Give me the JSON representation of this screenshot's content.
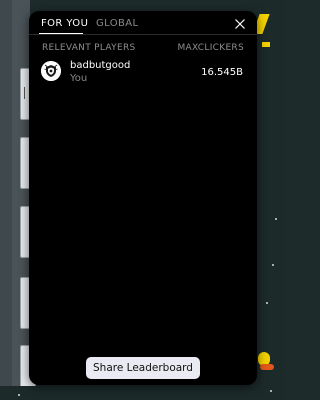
{
  "tabs": [
    {
      "label": "FOR YOU",
      "active": true
    },
    {
      "label": "GLOBAL",
      "active": false
    }
  ],
  "close_icon": "close-icon",
  "columns": {
    "players": "RELEVANT PLAYERS",
    "score": "MAXCLICKERS"
  },
  "players": [
    {
      "name": "badbutgood",
      "subtitle": "You",
      "score": "16.545B",
      "avatar_icon": "shield-crest-avatar"
    }
  ],
  "share_button": "Share Leaderboard",
  "colors": {
    "panel_bg": "#000000",
    "muted_text": "#8a8a8a",
    "button_bg": "#e9eaf2",
    "accent_yellow": "#f4d100",
    "accent_orange": "#e2571d"
  }
}
